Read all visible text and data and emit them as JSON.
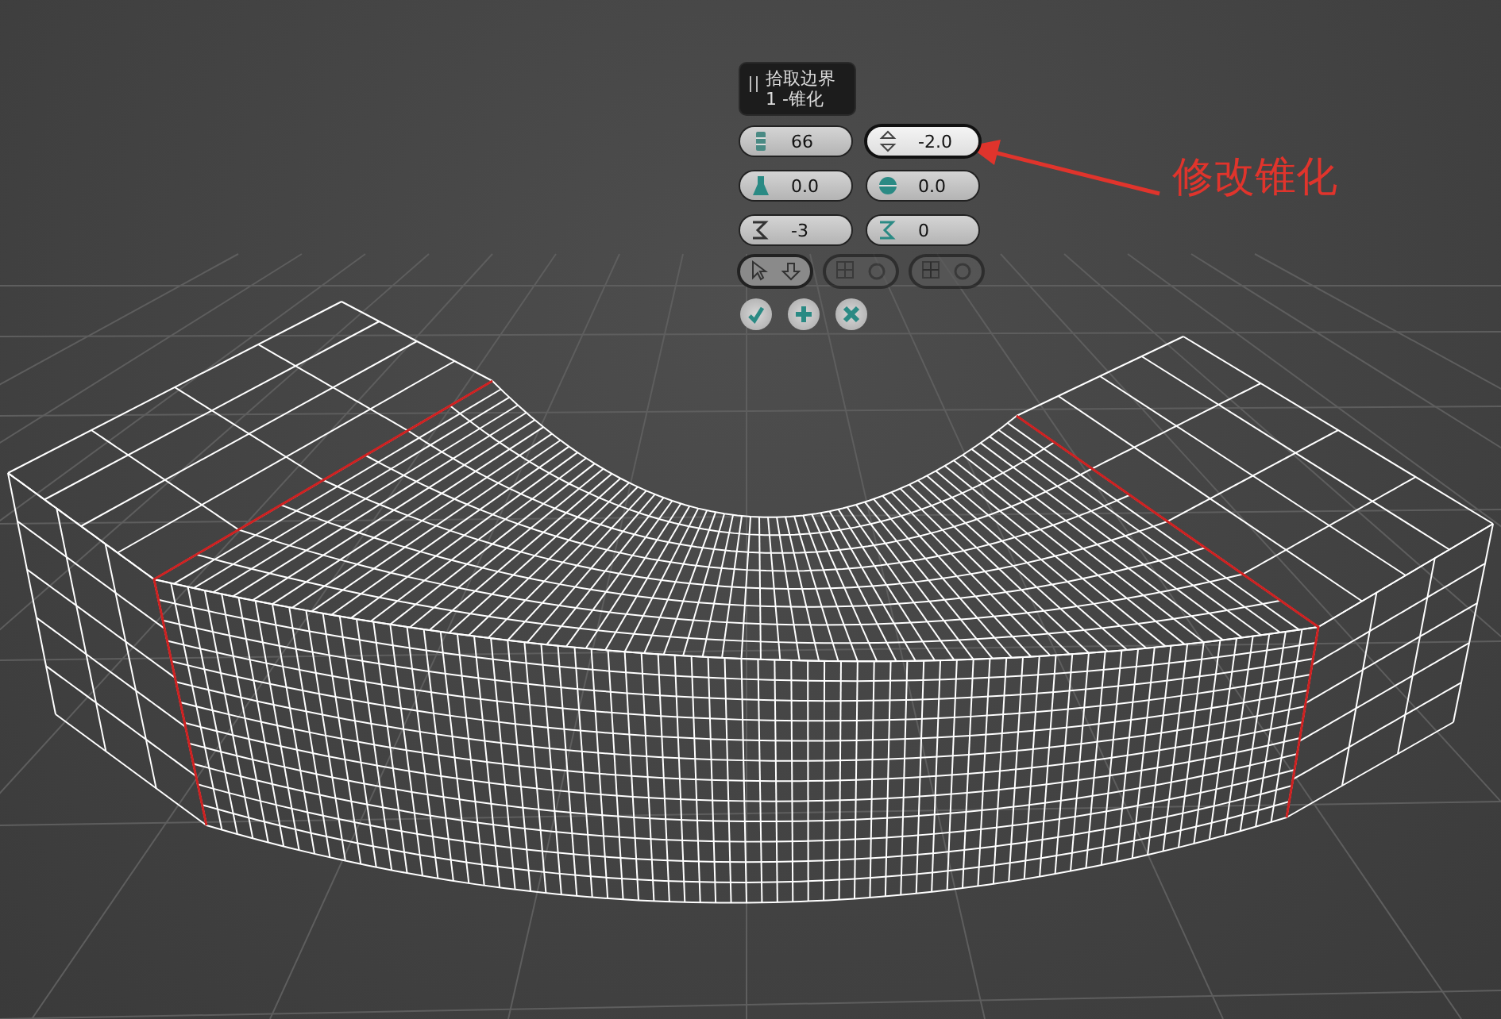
{
  "caddy": {
    "title": "拾取边界 1 -锥化",
    "fields": [
      {
        "kind": "segments",
        "value": "66",
        "selected": false
      },
      {
        "kind": "taper",
        "value": "-2.0",
        "selected": true
      },
      {
        "kind": "bias",
        "value": "0.0",
        "selected": false
      },
      {
        "kind": "sphere",
        "value": "0.0",
        "selected": false
      },
      {
        "kind": "rotate-a",
        "value": "-3",
        "selected": false
      },
      {
        "kind": "rotate-b",
        "value": "0",
        "selected": false
      }
    ],
    "tools": [
      {
        "kind": "pick",
        "disabled": false
      },
      {
        "kind": "grid-a",
        "disabled": true
      },
      {
        "kind": "grid-b",
        "disabled": true
      }
    ],
    "actions": [
      {
        "kind": "ok"
      },
      {
        "kind": "apply"
      },
      {
        "kind": "cancel"
      }
    ]
  },
  "annotation": {
    "text": "修改锥化"
  }
}
